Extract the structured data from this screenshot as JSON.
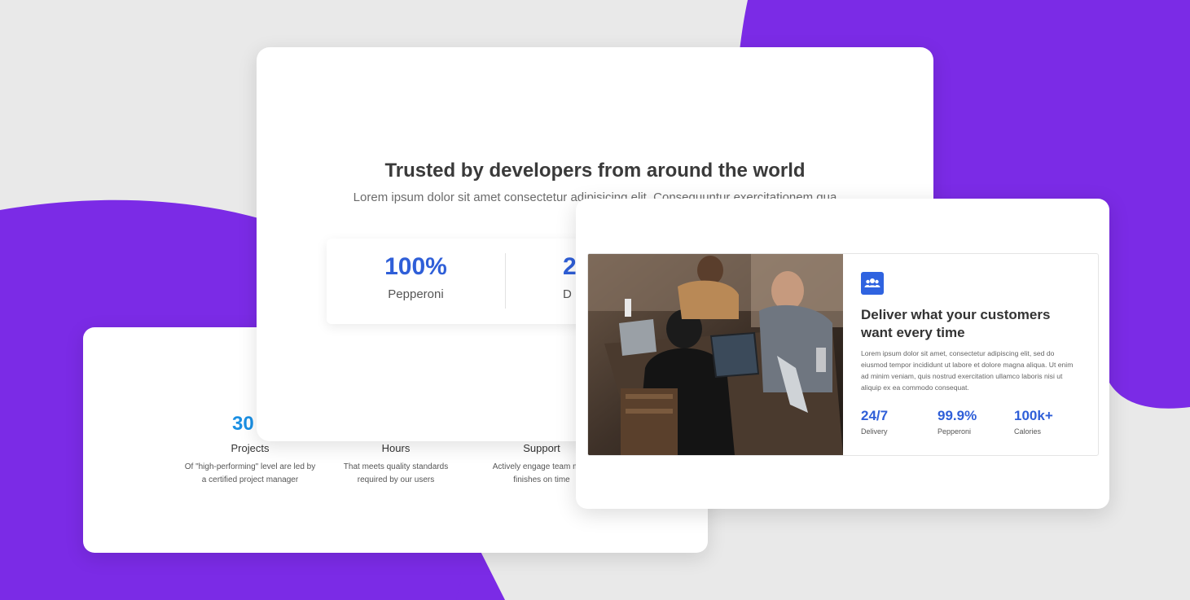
{
  "colors": {
    "accent_purple": "#7b2be6",
    "stat_blue": "#2f5fd8",
    "light_blue": "#1a8fe3",
    "background": "#e9e9e9"
  },
  "back_card": {
    "partial_number": "30",
    "columns": [
      {
        "label": "Projects",
        "desc_line1": "Of \"high-performing\" level are led by",
        "desc_line2": "a certified project manager"
      },
      {
        "label": "Hours",
        "desc_line1": "That meets quality standards",
        "desc_line2": "required by our users"
      },
      {
        "label": "Support",
        "desc_line1": "Actively engage team mem",
        "desc_line2": "finishes on time"
      }
    ]
  },
  "center_card": {
    "title": "Trusted by developers from around the world",
    "subtitle": "Lorem ipsum dolor sit amet consectetur adipisicing elit. Consequuntur exercitationem qua",
    "stats": [
      {
        "value": "100%",
        "label": "Pepperoni"
      },
      {
        "value": "2",
        "label": "D"
      }
    ]
  },
  "front_card": {
    "icon": "team-icon",
    "title": "Deliver what your customers want every time",
    "body": "Lorem ipsum dolor sit amet, consectetur adipiscing elit, sed do eiusmod tempor incididunt ut labore et dolore magna aliqua. Ut enim ad minim veniam, quis nostrud exercitation ullamco laboris nisi ut aliquip ex ea commodo consequat.",
    "stats": [
      {
        "value": "24/7",
        "label": "Delivery"
      },
      {
        "value": "99.9%",
        "label": "Pepperoni"
      },
      {
        "value": "100k+",
        "label": "Calories"
      }
    ]
  }
}
